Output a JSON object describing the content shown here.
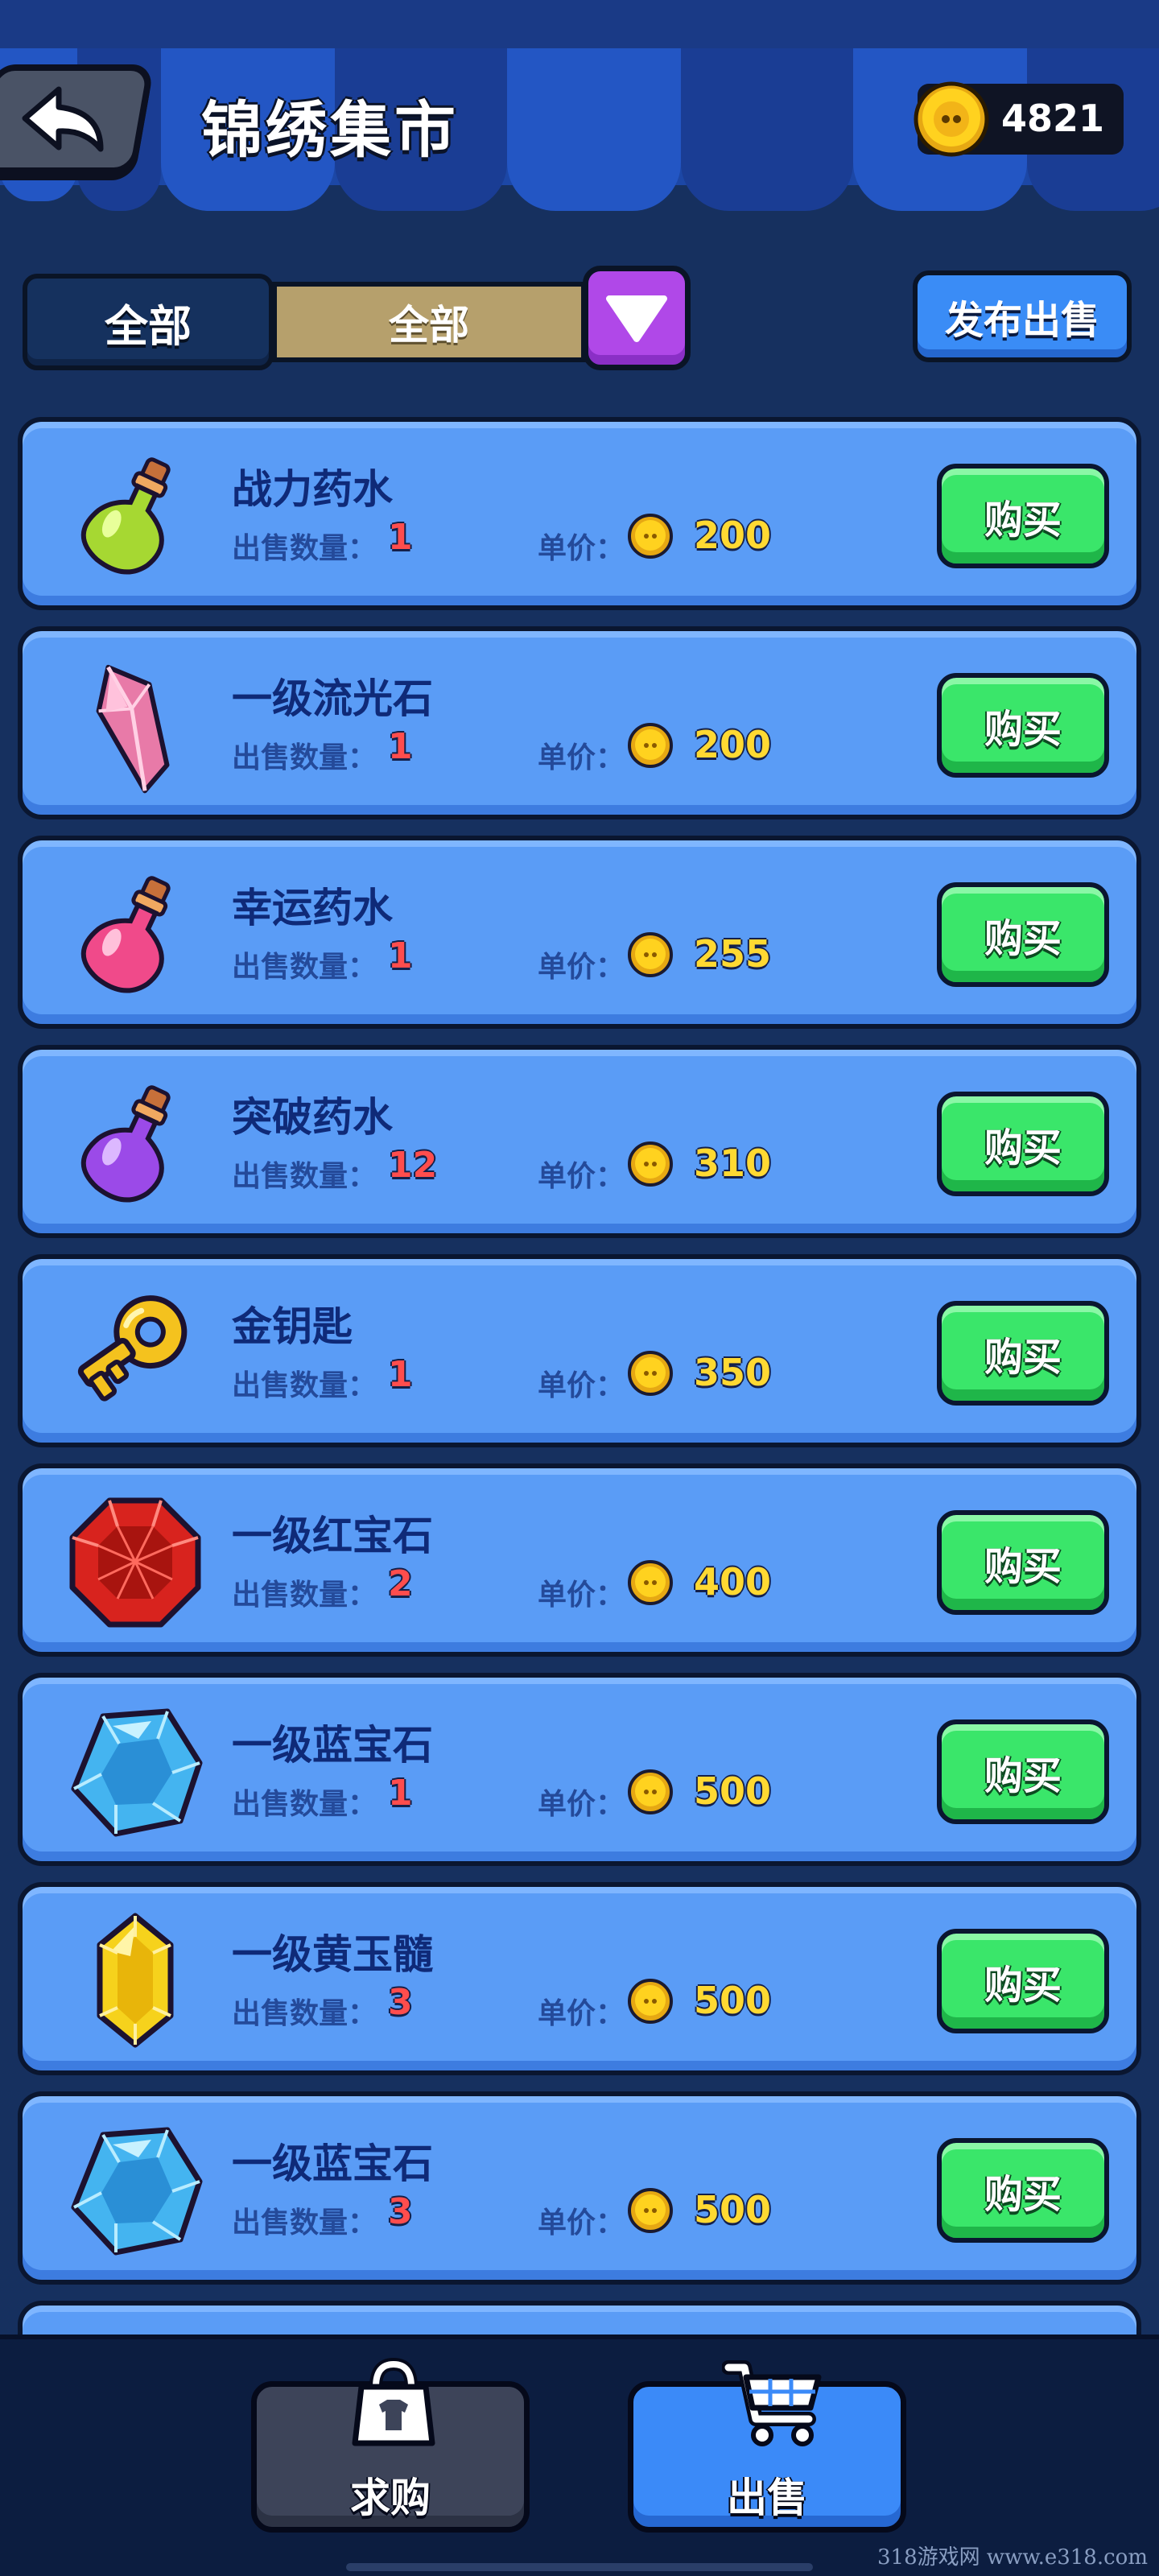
{
  "header": {
    "title": "锦绣集市",
    "coins": "4821"
  },
  "filter": {
    "category_label": "全部",
    "selected_value": "全部",
    "publish_button": "发布出售"
  },
  "labels": {
    "quantity": "出售数量：",
    "unit_price": "单价：",
    "buy_button": "购买"
  },
  "items": [
    {
      "name": "战力药水",
      "quantity": "1",
      "price": "200",
      "icon": "green-potion-icon"
    },
    {
      "name": "一级流光石",
      "quantity": "1",
      "price": "200",
      "icon": "pink-crystal-icon"
    },
    {
      "name": "幸运药水",
      "quantity": "1",
      "price": "255",
      "icon": "pink-potion-icon"
    },
    {
      "name": "突破药水",
      "quantity": "12",
      "price": "310",
      "icon": "purple-potion-icon"
    },
    {
      "name": "金钥匙",
      "quantity": "1",
      "price": "350",
      "icon": "golden-key-icon"
    },
    {
      "name": "一级红宝石",
      "quantity": "2",
      "price": "400",
      "icon": "red-gem-icon"
    },
    {
      "name": "一级蓝宝石",
      "quantity": "1",
      "price": "500",
      "icon": "blue-gem-icon"
    },
    {
      "name": "一级黄玉髓",
      "quantity": "3",
      "price": "500",
      "icon": "yellow-gem-icon"
    },
    {
      "name": "一级蓝宝石",
      "quantity": "3",
      "price": "500",
      "icon": "blue-gem-icon"
    }
  ],
  "bottom_tabs": [
    {
      "label": "求购",
      "icon": "shopping-bag-icon",
      "active": false
    },
    {
      "label": "出售",
      "icon": "cart-icon",
      "active": true
    }
  ],
  "watermark": "318游戏网 www.e318.com",
  "colors": {
    "card": "#5a9cf6",
    "buy_button": "#3ae66a",
    "price": "#ffd932",
    "quantity": "#ff4d4d",
    "dropdown": "#b048e8"
  }
}
